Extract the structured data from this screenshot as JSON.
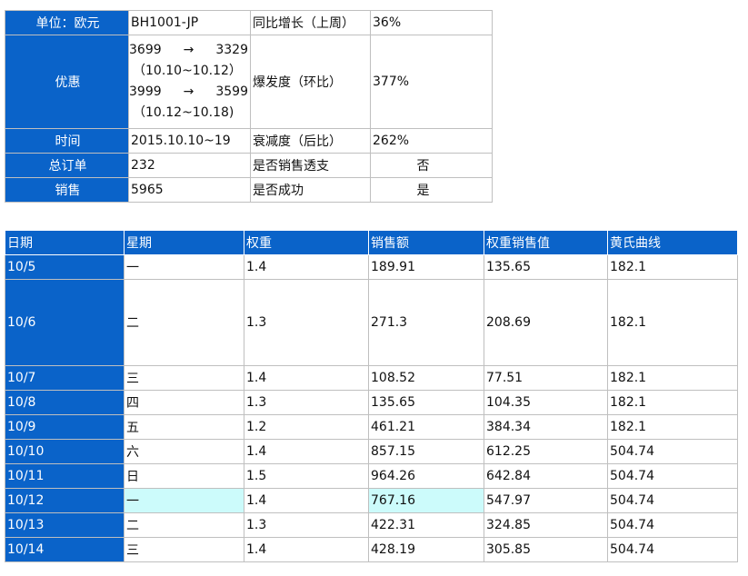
{
  "summary": {
    "unit_label": "单位：欧元",
    "sku": "BH1001-JP",
    "yoy_label": "同比增长（上周）",
    "yoy_value": "36%",
    "promo_label": "优惠",
    "promo": [
      {
        "from": "3699",
        "arrow": "→",
        "to": "3329",
        "dates": "（10.10~10.12）"
      },
      {
        "from": "3999",
        "arrow": "→",
        "to": "3599",
        "dates": "（10.12~10.18)"
      }
    ],
    "burst_label": "爆发度（环比）",
    "burst_value": "377%",
    "time_label": "时间",
    "time_value": "2015.10.10~19",
    "decay_label": "衰减度（后比）",
    "decay_value": "262%",
    "orders_label": "总订单",
    "orders_value": "232",
    "overdraft_label": "是否销售透支",
    "overdraft_value": "否",
    "sales_label": "销售",
    "sales_value": "5965",
    "success_label": "是否成功",
    "success_value": "是"
  },
  "sales_table": {
    "headers": [
      "日期",
      "星期",
      "权重",
      "销售额",
      "权重销售值",
      "黄氏曲线"
    ],
    "rows": [
      [
        "10/5",
        "一",
        "1.4",
        "189.91",
        "135.65",
        "182.1"
      ],
      [
        "10/6",
        "二",
        "1.3",
        "271.3",
        "208.69",
        "182.1"
      ],
      [
        "10/7",
        "三",
        "1.4",
        "108.52",
        "77.51",
        "182.1"
      ],
      [
        "10/8",
        "四",
        "1.3",
        "135.65",
        "104.35",
        "182.1"
      ],
      [
        "10/9",
        "五",
        "1.2",
        "461.21",
        "384.34",
        "182.1"
      ],
      [
        "10/10",
        "六",
        "1.4",
        "857.15",
        "612.25",
        "504.74"
      ],
      [
        "10/11",
        "日",
        "1.5",
        "964.26",
        "642.84",
        "504.74"
      ],
      [
        "10/12",
        "一",
        "1.4",
        "767.16",
        "547.97",
        "504.74"
      ],
      [
        "10/13",
        "二",
        "1.3",
        "422.31",
        "324.85",
        "504.74"
      ],
      [
        "10/14",
        "三",
        "1.4",
        "428.19",
        "305.85",
        "504.74"
      ]
    ],
    "highlight_color": "#ccfbfb",
    "header_color": "#0a63c9"
  }
}
